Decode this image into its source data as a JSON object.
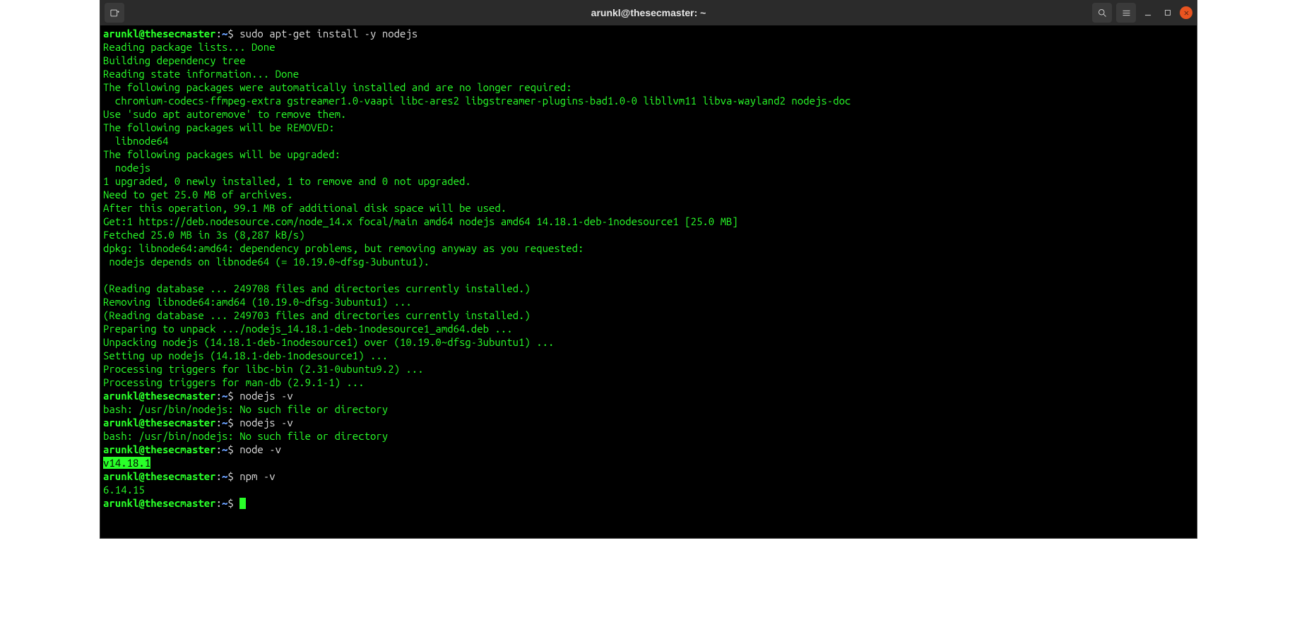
{
  "titlebar": {
    "title": "arunkl@thesecmaster: ~"
  },
  "prompt": {
    "userhost": "arunkl@thesecmaster",
    "sep": ":",
    "path": "~",
    "sigil": "$"
  },
  "session": [
    {
      "t": "cmd",
      "text": "sudo apt-get install -y nodejs"
    },
    {
      "t": "out",
      "text": "Reading package lists... Done"
    },
    {
      "t": "out",
      "text": "Building dependency tree"
    },
    {
      "t": "out",
      "text": "Reading state information... Done"
    },
    {
      "t": "out",
      "text": "The following packages were automatically installed and are no longer required:"
    },
    {
      "t": "out",
      "text": "  chromium-codecs-ffmpeg-extra gstreamer1.0-vaapi libc-ares2 libgstreamer-plugins-bad1.0-0 libllvm11 libva-wayland2 nodejs-doc"
    },
    {
      "t": "out",
      "text": "Use 'sudo apt autoremove' to remove them."
    },
    {
      "t": "out",
      "text": "The following packages will be REMOVED:"
    },
    {
      "t": "out",
      "text": "  libnode64"
    },
    {
      "t": "out",
      "text": "The following packages will be upgraded:"
    },
    {
      "t": "out",
      "text": "  nodejs"
    },
    {
      "t": "out",
      "text": "1 upgraded, 0 newly installed, 1 to remove and 0 not upgraded."
    },
    {
      "t": "out",
      "text": "Need to get 25.0 MB of archives."
    },
    {
      "t": "out",
      "text": "After this operation, 99.1 MB of additional disk space will be used."
    },
    {
      "t": "out",
      "text": "Get:1 https://deb.nodesource.com/node_14.x focal/main amd64 nodejs amd64 14.18.1-deb-1nodesource1 [25.0 MB]"
    },
    {
      "t": "out",
      "text": "Fetched 25.0 MB in 3s (8,287 kB/s)"
    },
    {
      "t": "out",
      "text": "dpkg: libnode64:amd64: dependency problems, but removing anyway as you requested:"
    },
    {
      "t": "out",
      "text": " nodejs depends on libnode64 (= 10.19.0~dfsg-3ubuntu1)."
    },
    {
      "t": "out",
      "text": ""
    },
    {
      "t": "out",
      "text": "(Reading database ... 249708 files and directories currently installed.)"
    },
    {
      "t": "out",
      "text": "Removing libnode64:amd64 (10.19.0~dfsg-3ubuntu1) ..."
    },
    {
      "t": "out",
      "text": "(Reading database ... 249703 files and directories currently installed.)"
    },
    {
      "t": "out",
      "text": "Preparing to unpack .../nodejs_14.18.1-deb-1nodesource1_amd64.deb ..."
    },
    {
      "t": "out",
      "text": "Unpacking nodejs (14.18.1-deb-1nodesource1) over (10.19.0~dfsg-3ubuntu1) ..."
    },
    {
      "t": "out",
      "text": "Setting up nodejs (14.18.1-deb-1nodesource1) ..."
    },
    {
      "t": "out",
      "text": "Processing triggers for libc-bin (2.31-0ubuntu9.2) ..."
    },
    {
      "t": "out",
      "text": "Processing triggers for man-db (2.9.1-1) ..."
    },
    {
      "t": "cmd",
      "text": "nodejs -v"
    },
    {
      "t": "out",
      "text": "bash: /usr/bin/nodejs: No such file or directory"
    },
    {
      "t": "cmd",
      "text": "nodejs -v"
    },
    {
      "t": "out",
      "text": "bash: /usr/bin/nodejs: No such file or directory"
    },
    {
      "t": "cmd",
      "text": "node -v"
    },
    {
      "t": "hl",
      "text": "v14.18.1"
    },
    {
      "t": "cmd",
      "text": "npm -v"
    },
    {
      "t": "out",
      "text": "6.14.15"
    },
    {
      "t": "prompt-cursor"
    }
  ]
}
